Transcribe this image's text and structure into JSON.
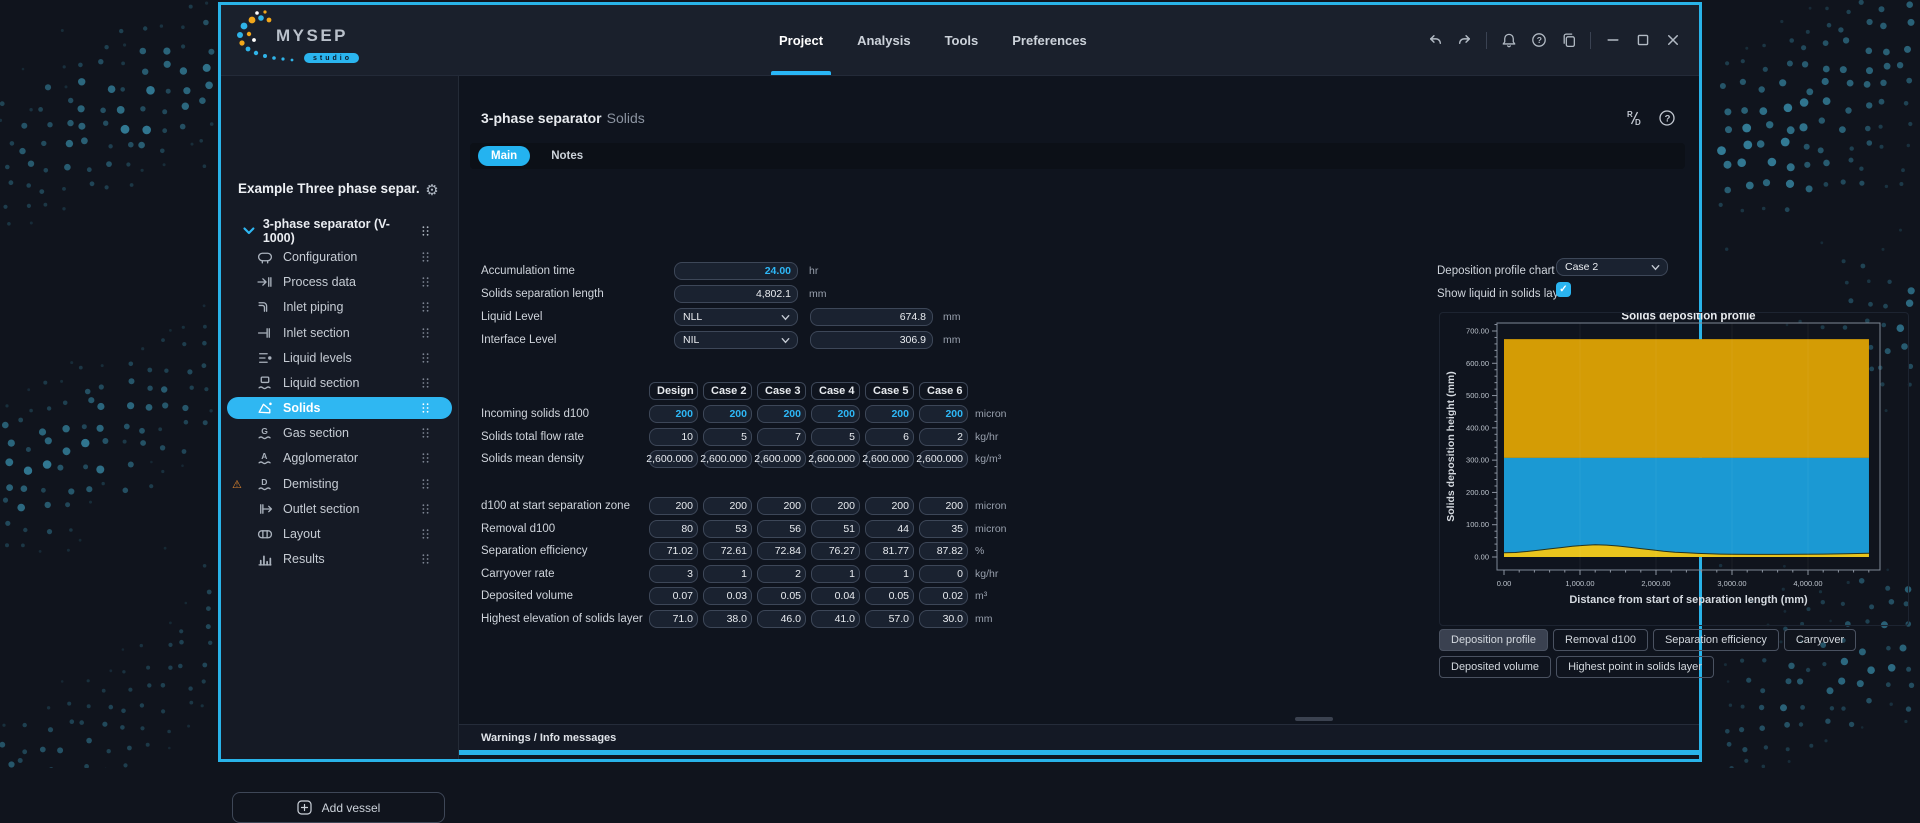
{
  "window": {
    "logo": {
      "text": "MYSEP",
      "sub": "studio"
    },
    "menu": {
      "items": [
        {
          "label": "Project",
          "active": true
        },
        {
          "label": "Analysis",
          "active": false
        },
        {
          "label": "Tools",
          "active": false
        },
        {
          "label": "Preferences",
          "active": false
        }
      ]
    },
    "titlebar_icons": [
      "undo",
      "redo",
      "sep",
      "bell",
      "help",
      "copy",
      "sep",
      "minimize",
      "maximize",
      "close"
    ]
  },
  "sidebar": {
    "project_title": "Example Three phase separ...",
    "vessel_label": "3-phase separator (V-1000)",
    "items": [
      {
        "label": "Configuration",
        "icon": "configuration-icon"
      },
      {
        "label": "Process data",
        "icon": "process-data-icon"
      },
      {
        "label": "Inlet piping",
        "icon": "inlet-piping-icon"
      },
      {
        "label": "Inlet section",
        "icon": "inlet-section-icon"
      },
      {
        "label": "Liquid levels",
        "icon": "liquid-levels-icon"
      },
      {
        "label": "Liquid section",
        "icon": "liquid-section-icon"
      },
      {
        "label": "Solids",
        "icon": "solids-icon",
        "selected": true
      },
      {
        "label": "Gas section",
        "icon": "gas-section-icon"
      },
      {
        "label": "Agglomerator",
        "icon": "agglomerator-icon"
      },
      {
        "label": "Demisting",
        "icon": "demisting-icon",
        "warning": true
      },
      {
        "label": "Outlet section",
        "icon": "outlet-section-icon"
      },
      {
        "label": "Layout",
        "icon": "layout-icon"
      },
      {
        "label": "Results",
        "icon": "results-icon"
      }
    ],
    "add_vessel_label": "Add vessel"
  },
  "main": {
    "title": "3-phase separator",
    "subtitle": "Solids",
    "tabs": [
      {
        "label": "Main",
        "active": true
      },
      {
        "label": "Notes",
        "active": false
      }
    ],
    "form": {
      "rows": [
        {
          "label": "Accumulation time",
          "type": "input",
          "value": "24.00",
          "accent": true,
          "unit": "hr"
        },
        {
          "label": "Solids separation length",
          "type": "input",
          "value": "4,802.1",
          "accent": false,
          "unit": "mm"
        },
        {
          "label": "Liquid Level",
          "type": "select_input",
          "select": "NLL",
          "value": "674.8",
          "accent": false,
          "unit": "mm"
        },
        {
          "label": "Interface Level",
          "type": "select_input",
          "select": "NIL",
          "value": "306.9",
          "accent": false,
          "unit": "mm"
        }
      ]
    },
    "table": {
      "columns": [
        "Design",
        "Case 2",
        "Case 3",
        "Case 4",
        "Case 5",
        "Case 6"
      ],
      "group1": [
        {
          "label": "Incoming solids d100",
          "values": [
            "200",
            "200",
            "200",
            "200",
            "200",
            "200"
          ],
          "unit": "micron",
          "accent": true
        },
        {
          "label": "Solids total flow rate",
          "values": [
            "10",
            "5",
            "7",
            "5",
            "6",
            "2"
          ],
          "unit": "kg/hr",
          "accent": false
        },
        {
          "label": "Solids mean density",
          "values": [
            "2,600.000",
            "2,600.000",
            "2,600.000",
            "2,600.000",
            "2,600.000",
            "2,600.000"
          ],
          "unit": "kg/m³",
          "accent": false
        }
      ],
      "group2": [
        {
          "label": "d100 at start separation zone",
          "values": [
            "200",
            "200",
            "200",
            "200",
            "200",
            "200"
          ],
          "unit": "micron",
          "accent": false
        },
        {
          "label": "Removal d100",
          "values": [
            "80",
            "53",
            "56",
            "51",
            "44",
            "35"
          ],
          "unit": "micron",
          "accent": false
        },
        {
          "label": "Separation efficiency",
          "values": [
            "71.02",
            "72.61",
            "72.84",
            "76.27",
            "81.77",
            "87.82"
          ],
          "unit": "%",
          "accent": false
        },
        {
          "label": "Carryover rate",
          "values": [
            "3",
            "1",
            "2",
            "1",
            "1",
            "0"
          ],
          "unit": "kg/hr",
          "accent": false
        },
        {
          "label": "Deposited volume",
          "values": [
            "0.07",
            "0.03",
            "0.05",
            "0.04",
            "0.05",
            "0.02"
          ],
          "unit": "m³",
          "accent": false
        },
        {
          "label": "Highest elevation of solids layer",
          "values": [
            "71.0",
            "38.0",
            "46.0",
            "41.0",
            "57.0",
            "30.0"
          ],
          "unit": "mm",
          "accent": false
        }
      ]
    },
    "right": {
      "chart_select_label": "Deposition profile chart",
      "chart_select_value": "Case 2",
      "show_liquid_label": "Show liquid in solids layer",
      "show_liquid_checked": true,
      "checkmark": "✓"
    },
    "chart_tabs": [
      {
        "label": "Deposition profile",
        "active": true
      },
      {
        "label": "Removal d100",
        "active": false
      },
      {
        "label": "Separation efficiency",
        "active": false
      },
      {
        "label": "Carryover",
        "active": false
      },
      {
        "label": "Deposited volume",
        "active": false
      },
      {
        "label": "Highest point in solids layer",
        "active": false
      }
    ],
    "warnings_label": "Warnings / Info messages"
  },
  "chart_data": {
    "type": "area",
    "title": "Solids deposition profile",
    "xlabel": "Distance from start of separation length (mm)",
    "ylabel": "Solids deposition height (mm)",
    "xlim": [
      0,
      4947
    ],
    "ylim": [
      -28,
      736
    ],
    "x_ticks": [
      0,
      1000,
      2000,
      3000,
      4000
    ],
    "x_tick_labels": [
      "0.00",
      "1,000.00",
      "2,000.00",
      "3,000.00",
      "4,000.00"
    ],
    "y_ticks": [
      0,
      100,
      200,
      300,
      400,
      500,
      600,
      700
    ],
    "y_tick_labels": [
      "0.00",
      "100.00",
      "200.00",
      "300.00",
      "400.00",
      "500.00",
      "600.00",
      "700.00"
    ],
    "x_data_max": 4802.1,
    "selected_case": "Case 2",
    "liquid_level_mm": 674.8,
    "interface_level_mm": 306.9,
    "layers": [
      {
        "name": "upper-liquid",
        "color": "#d49c05",
        "from_mm": 306.9,
        "to_mm": 674.8
      },
      {
        "name": "lower-liquid",
        "color": "#1b99d3",
        "to_mm": 306.9
      },
      {
        "name": "solids-deposit",
        "color": "#e9c41d",
        "outline": "#26331d"
      }
    ],
    "solids_profile_mm": [
      [
        0,
        13
      ],
      [
        150,
        14
      ],
      [
        300,
        17
      ],
      [
        450,
        21
      ],
      [
        600,
        25
      ],
      [
        750,
        29
      ],
      [
        900,
        33
      ],
      [
        1050,
        36
      ],
      [
        1200,
        38
      ],
      [
        1350,
        37
      ],
      [
        1500,
        34
      ],
      [
        1650,
        30
      ],
      [
        1800,
        26
      ],
      [
        1950,
        22
      ],
      [
        2100,
        18
      ],
      [
        2250,
        15
      ],
      [
        2400,
        13
      ],
      [
        2550,
        11
      ],
      [
        2700,
        10
      ],
      [
        2850,
        9
      ],
      [
        3000,
        8.5
      ],
      [
        3300,
        8
      ],
      [
        3600,
        8
      ],
      [
        3900,
        8.5
      ],
      [
        4200,
        9
      ],
      [
        4500,
        10
      ],
      [
        4802,
        11.5
      ]
    ],
    "grid": "vertical-faint",
    "legend": "none"
  },
  "colors": {
    "accent": "#29b6f6",
    "window_border": "#29b3e8",
    "warning": "#e0862e",
    "chart_upper": "#d49c05",
    "chart_lower": "#1b99d3",
    "chart_solids": "#e9c41d"
  }
}
